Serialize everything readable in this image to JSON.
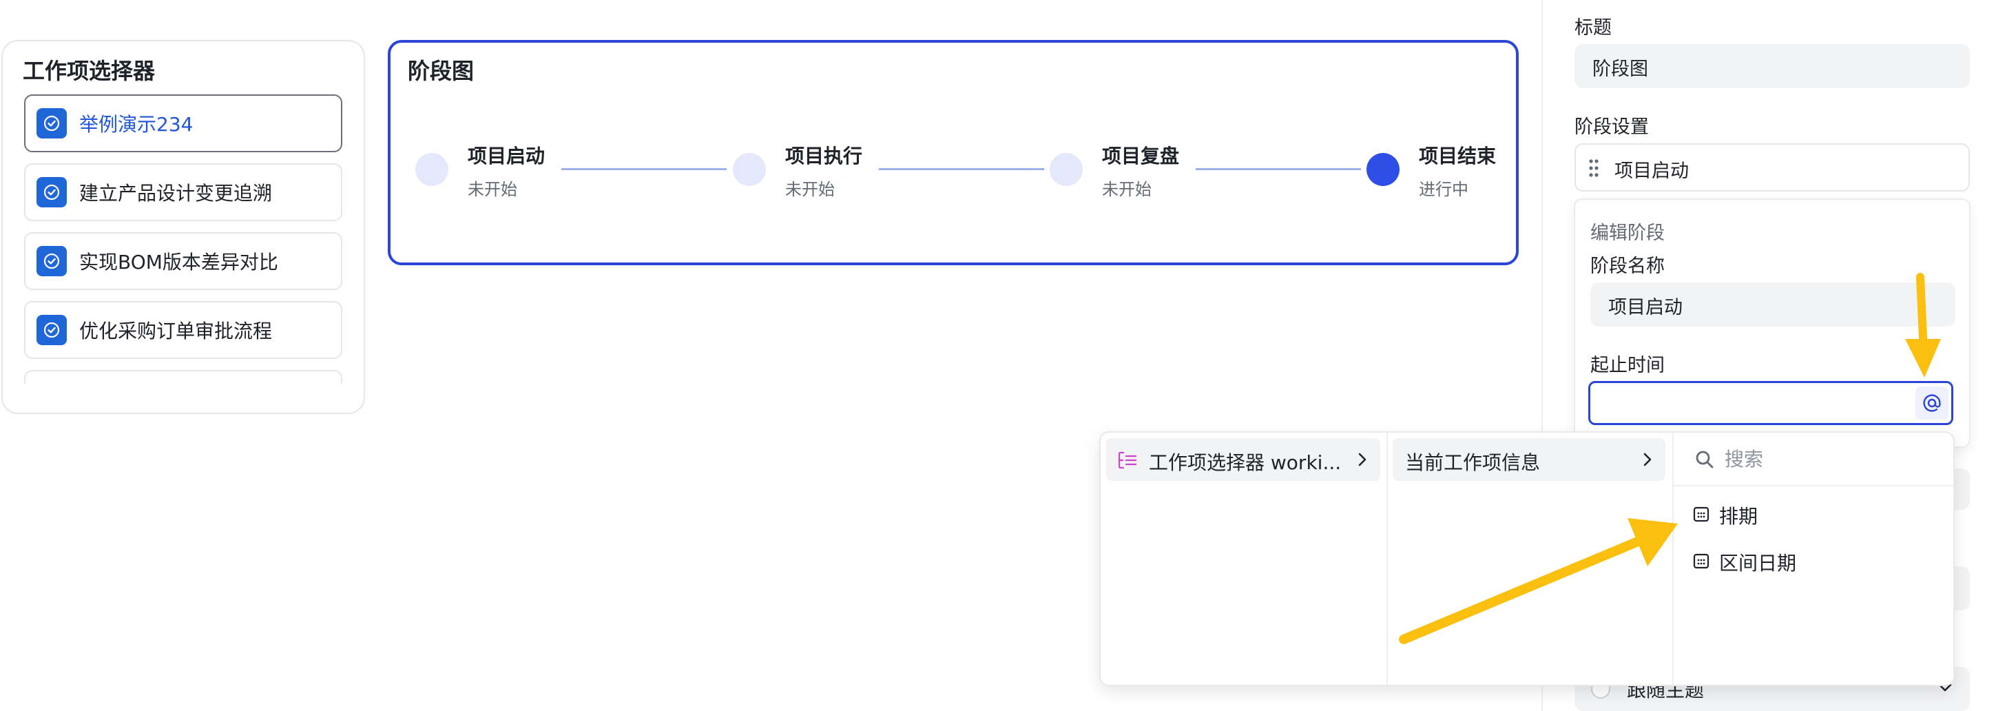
{
  "selector": {
    "title": "工作项选择器",
    "items": [
      {
        "label": "举例演示234",
        "selected": true
      },
      {
        "label": "建立产品设计变更追溯",
        "selected": false
      },
      {
        "label": "实现BOM版本差异对比",
        "selected": false
      },
      {
        "label": "优化采购订单审批流程",
        "selected": false
      }
    ]
  },
  "stage_chart": {
    "title": "阶段图",
    "stages": [
      {
        "name": "项目启动",
        "status": "未开始",
        "active": false
      },
      {
        "name": "项目执行",
        "status": "未开始",
        "active": false
      },
      {
        "name": "项目复盘",
        "status": "未开始",
        "active": false
      },
      {
        "name": "项目结束",
        "status": "进行中",
        "active": true
      }
    ]
  },
  "panel": {
    "title_label": "标题",
    "title_value": "阶段图",
    "stage_settings_label": "阶段设置",
    "stage_setting_item": "项目启动",
    "edit_stage": {
      "heading": "编辑阶段",
      "name_label": "阶段名称",
      "name_value": "项目启动",
      "date_label": "起止时间",
      "date_value": ""
    },
    "theme_option": "跟随主题"
  },
  "dropdown": {
    "col1_item": "工作项选择器 worki...",
    "col2_item": "当前工作项信息",
    "search_placeholder": "搜索",
    "fields": [
      "排期",
      "区间日期"
    ]
  },
  "colors": {
    "accent": "#2b45d6",
    "checkbox": "#1f67d8",
    "annotation_arrow": "#fbbf0f",
    "tree_icon": "#d63fd0"
  }
}
